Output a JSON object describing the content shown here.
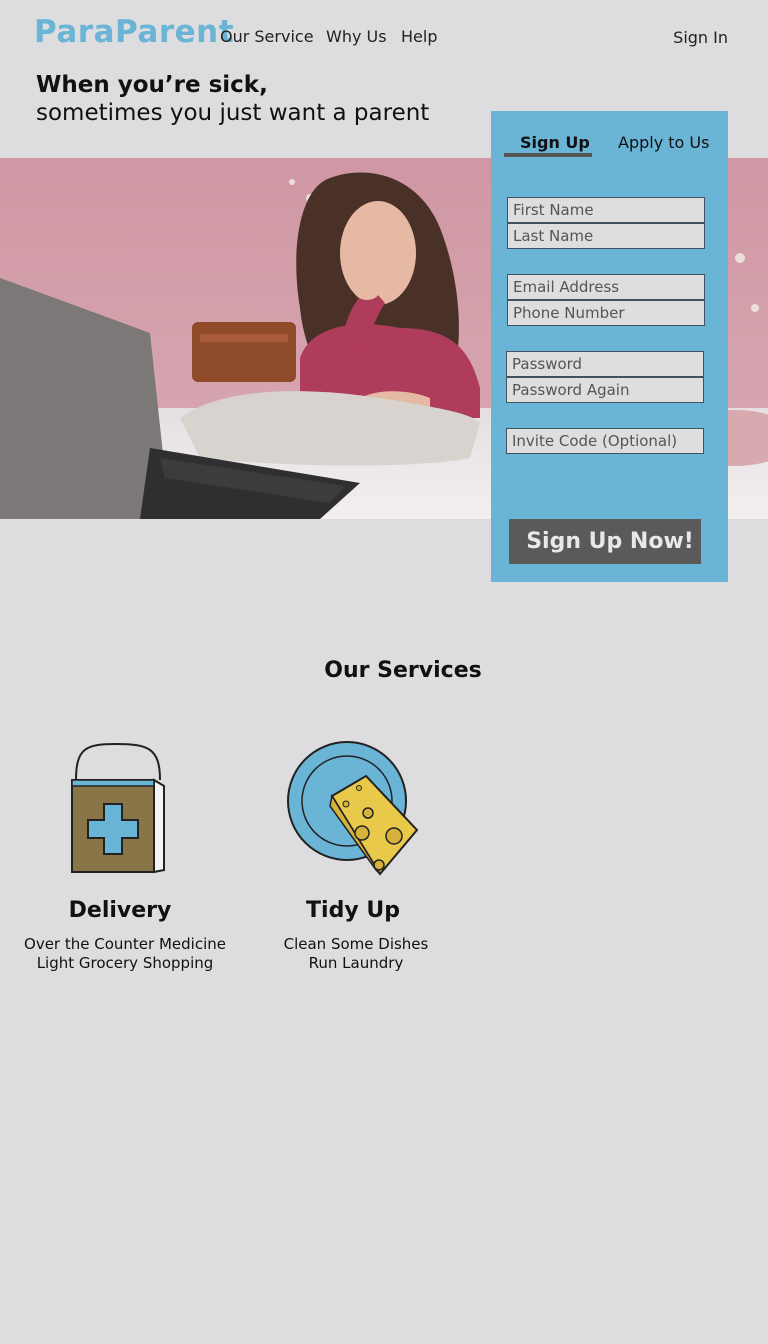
{
  "header": {
    "logo": "ParaParent",
    "nav": [
      "Our Service",
      "Why Us",
      "Help"
    ],
    "sign_in": "Sign In"
  },
  "hero": {
    "headline_line1": "When you’re sick,",
    "headline_line2": "sometimes you just want a parent"
  },
  "signup": {
    "tabs": [
      "Sign Up",
      "Apply to Us"
    ],
    "active_tab": "Sign Up",
    "fields": {
      "first_name": "First Name",
      "last_name": "Last Name",
      "email": "Email Address",
      "phone": "Phone Number",
      "password": "Password",
      "password_again": "Password Again",
      "invite_code": "Invite Code (Optional)"
    },
    "submit_label": "Sign Up Now!"
  },
  "services": {
    "title": "Our Services",
    "items": [
      {
        "title": "Delivery",
        "icon": "medicine-bag-icon",
        "lines": [
          "Over the Counter Medicine",
          "Light Grocery Shopping"
        ]
      },
      {
        "title": "Tidy Up",
        "icon": "plate-sponge-icon",
        "lines": [
          "Clean Some Dishes",
          "Run Laundry"
        ]
      }
    ]
  },
  "colors": {
    "accent": "#6ab4d6",
    "background": "#dddcdf",
    "button": "#5a5a5a"
  }
}
